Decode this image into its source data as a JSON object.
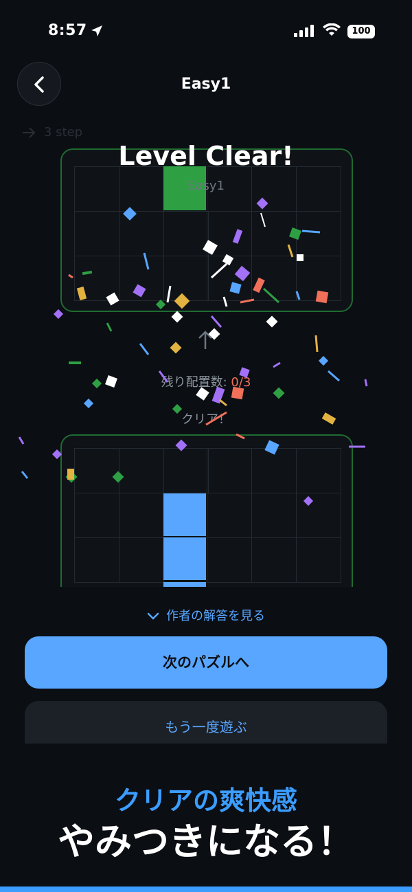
{
  "status_bar": {
    "time": "8:57",
    "battery": "100"
  },
  "header": {
    "title": "Easy1"
  },
  "step": {
    "label": "3 step"
  },
  "clear": {
    "title": "Level Clear!",
    "subtitle": "Easy1"
  },
  "info": {
    "remaining_label": "残り配置数:",
    "remaining_value": "0/3",
    "clear_label": "クリア！"
  },
  "actions": {
    "show_answer": "作者の解答を見る",
    "next_puzzle": "次のパズルへ",
    "play_again": "もう一度遊ぶ"
  },
  "promo": {
    "subtitle": "クリアの爽快感",
    "title": "やみつきになる！"
  },
  "colors": {
    "accent": "#58a6ff",
    "green_cell": "#2ea043",
    "blue_cell": "#58a6ff",
    "remaining_highlight": "#f0705a",
    "background": "#0b0e13"
  },
  "icons": [
    "location-arrow-icon",
    "signal-icon",
    "wifi-icon",
    "battery-icon",
    "back-chevron-icon",
    "arrow-right-icon",
    "arrow-up-icon",
    "chevron-down-icon"
  ]
}
